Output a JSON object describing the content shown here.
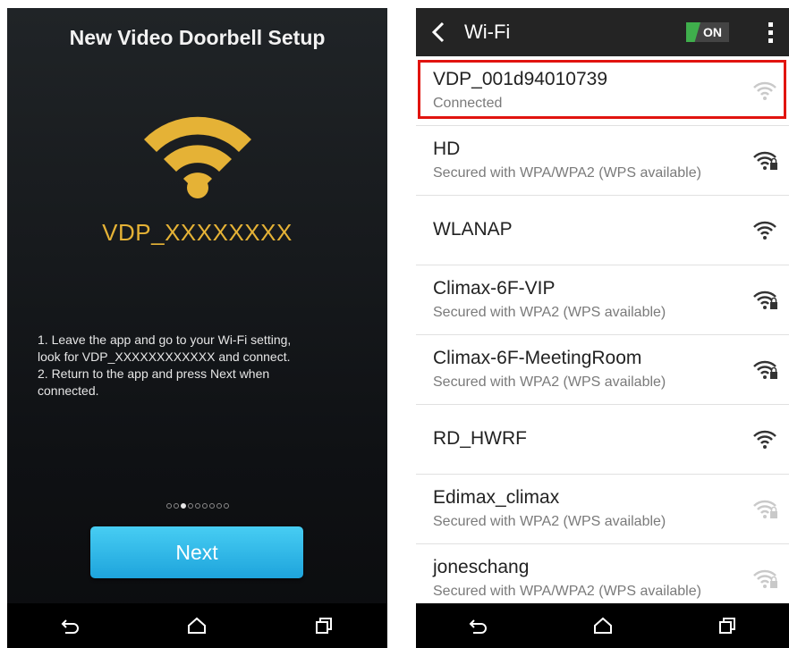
{
  "left_screen": {
    "title": "New Video Doorbell Setup",
    "ssid": "VDP_XXXXXXXX",
    "instructions": [
      "1. Leave the app and go to your Wi-Fi setting,",
      "look for VDP_XXXXXXXXXXXX and connect.",
      "2. Return to the app and press Next when",
      "connected."
    ],
    "page_indicator": {
      "total": 9,
      "current": 3
    },
    "next_label": "Next",
    "icons": {
      "wifi": "wifi-icon",
      "back": "back-icon",
      "home": "home-icon",
      "recents": "recents-icon"
    },
    "accent_color": "#e5b236",
    "button_color": "#2bb4e6"
  },
  "right_screen": {
    "header_title": "Wi-Fi",
    "toggle_label": "ON",
    "toggle_color": "#3fae4c",
    "highlight_color": "#e1140f",
    "networks": [
      {
        "name": "VDP_001d94010739",
        "status": "Connected",
        "locked": false,
        "faded": true
      },
      {
        "name": "HD",
        "status": "Secured with WPA/WPA2 (WPS available)",
        "locked": true,
        "faded": false
      },
      {
        "name": "WLANAP",
        "status": "",
        "locked": false,
        "faded": false
      },
      {
        "name": "Climax-6F-VIP",
        "status": "Secured with WPA2 (WPS available)",
        "locked": true,
        "faded": false
      },
      {
        "name": "Climax-6F-MeetingRoom",
        "status": "Secured with WPA2 (WPS available)",
        "locked": true,
        "faded": false
      },
      {
        "name": "RD_HWRF",
        "status": "",
        "locked": false,
        "faded": false
      },
      {
        "name": "Edimax_climax",
        "status": "Secured with WPA2 (WPS available)",
        "locked": true,
        "faded": true
      },
      {
        "name": "joneschang",
        "status": "Secured with WPA/WPA2 (WPS available)",
        "locked": true,
        "faded": true
      }
    ]
  }
}
